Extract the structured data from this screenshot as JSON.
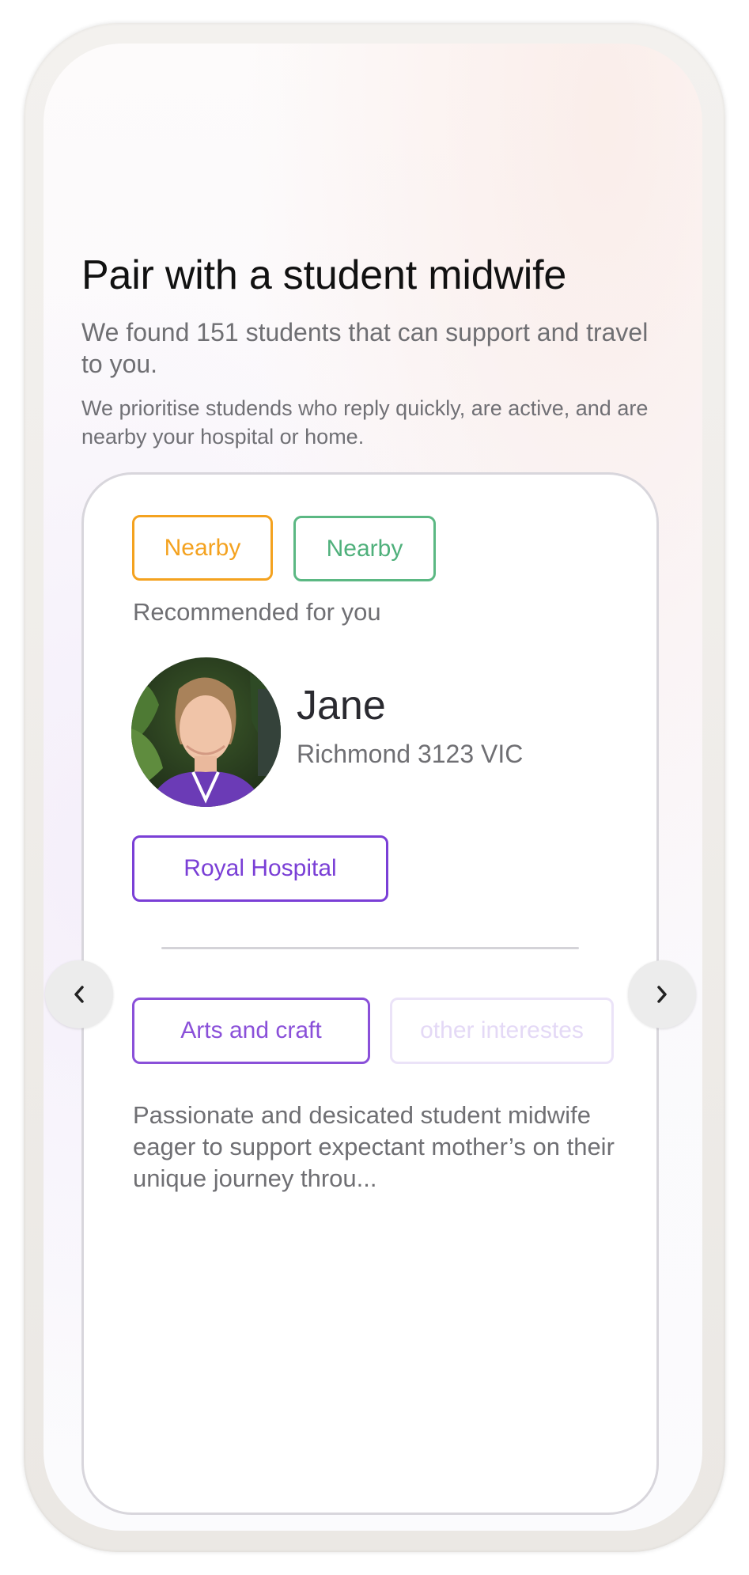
{
  "header": {
    "title": "Pair with a student midwife",
    "subtitle": "We found 151 students that can support and travel to you.",
    "note": "We prioritise studends who reply quickly, are active, and are nearby your hospital or home."
  },
  "card": {
    "tags": [
      {
        "label": "Nearby",
        "color": "#f4a21f"
      },
      {
        "label": "Nearby",
        "color": "#4fb07b"
      }
    ],
    "recommended": "Recommended for you",
    "student": {
      "name": "Jane",
      "location": "Richmond 3123 VIC",
      "avatar_icon": "profile-photo"
    },
    "hospital": "Royal Hospital",
    "interests": [
      {
        "label": "Arts and craft",
        "active": true
      },
      {
        "label": "other interestes",
        "active": false
      }
    ],
    "bio": "Passionate and desicated student midwife eager to support expectant mother’s on their unique journey throu..."
  },
  "navigation": {
    "prev_icon": "chevron-left-icon",
    "next_icon": "chevron-right-icon"
  },
  "colors": {
    "accent_purple": "#7a3fd6",
    "orange": "#f4a21f",
    "green": "#4fb07b"
  }
}
